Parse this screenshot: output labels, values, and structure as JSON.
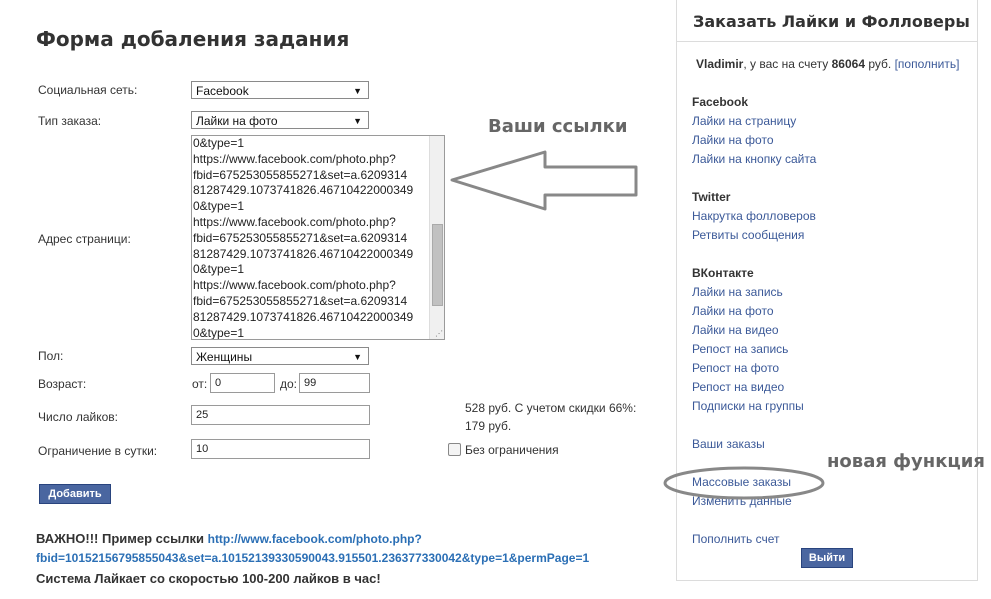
{
  "form": {
    "title": "Форма добаления задания",
    "social_network": {
      "label": "Социальная сеть:",
      "value": "Facebook"
    },
    "order_type": {
      "label": "Тип заказа:",
      "value": "Лайки на фото"
    },
    "page_address": {
      "label": "Адрес страници:",
      "value": "0&type=1\nhttps://www.facebook.com/photo.php?\nfbid=675253055855271&set=a.6209314\n81287429.1073741826.46710422000349\n0&type=1\nhttps://www.facebook.com/photo.php?\nfbid=675253055855271&set=a.6209314\n81287429.1073741826.46710422000349\n0&type=1\nhttps://www.facebook.com/photo.php?\nfbid=675253055855271&set=a.6209314\n81287429.1073741826.46710422000349\n0&type=1"
    },
    "gender": {
      "label": "Пол:",
      "value": "Женщины"
    },
    "age": {
      "label": "Возраст:",
      "from_label": "от:",
      "from_value": "0",
      "to_label": "до:",
      "to_value": "99"
    },
    "likes_count": {
      "label": "Число лайков:",
      "value": "25"
    },
    "price_text": "528 руб. С учетом скидки 66%:",
    "price_discounted": "179 руб.",
    "daily_limit": {
      "label": "Ограничение в сутки:",
      "value": "10"
    },
    "no_limit_label": "Без ограничения",
    "no_limit_checked": false,
    "submit_label": "Добавить"
  },
  "annotations": {
    "your_links": "Ваши ссылки",
    "new_feature": "новая функция"
  },
  "important": {
    "prefix": "ВАЖНО!!! Пример ссылки",
    "link_part1": "http://www.facebook.com/photo.php?",
    "link_part2": "fbid=10152156795855043&set=a.10152139330590043.915501.236377330042&type=1&permPage=1",
    "speed_note": "Система Лайкает со скоростью 100-200 лайков в час!"
  },
  "sidebar": {
    "title": "Заказать Лайки и Фолловеры",
    "user_name": "Vladimir",
    "balance_prefix": ", у вас на счету",
    "balance_amount": "86064",
    "balance_currency": "руб.",
    "top_up_link": "[пополнить]",
    "facebook": {
      "heading": "Facebook",
      "items": [
        "Лайки на страницу",
        "Лайки на фото",
        "Лайки на кнопку сайта"
      ]
    },
    "twitter": {
      "heading": "Twitter",
      "items": [
        "Накрутка фолловеров",
        "Ретвиты сообщения"
      ]
    },
    "vkontakte": {
      "heading": "ВКонтакте",
      "items": [
        "Лайки на запись",
        "Лайки на фото",
        "Лайки на видео",
        "Репост на запись",
        "Репост на фото",
        "Репост на видео",
        "Подписки на группы"
      ]
    },
    "account": {
      "your_orders": "Ваши заказы",
      "bulk_orders": "Массовые заказы",
      "change_data": "Изменить данные",
      "top_up_account": "Пополнить счет",
      "logout": "Выйти"
    }
  },
  "colors": {
    "link": "#3b5998",
    "button": "#4a66a0",
    "annotation": "#666666"
  }
}
